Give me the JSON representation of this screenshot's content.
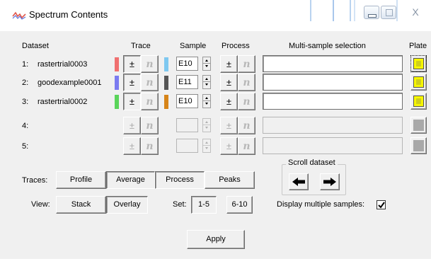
{
  "window": {
    "title": "Spectrum Contents",
    "close_glyph": "X"
  },
  "headers": {
    "dataset": "Dataset",
    "trace": "Trace",
    "sample": "Sample",
    "process": "Process",
    "multi_sample": "Multi-sample selection",
    "plate": "Plate"
  },
  "glyphs": {
    "toggle": "±",
    "n": "n"
  },
  "rows": [
    {
      "index": "1:",
      "name": "rastertrial0003",
      "color": "#f07070",
      "sample_color": "#7ec8f0",
      "sample": "E10",
      "plate_color": "yellow",
      "enabled": true
    },
    {
      "index": "2:",
      "name": "goodexample0001",
      "color": "#7b7bf0",
      "sample_color": "#555555",
      "sample": "E11",
      "plate_color": "yellow",
      "enabled": true
    },
    {
      "index": "3:",
      "name": "rastertrial0002",
      "color": "#5ad45a",
      "sample_color": "#d68418",
      "sample": "E10",
      "plate_color": "yellow",
      "enabled": true
    },
    {
      "index": "4:",
      "name": "",
      "sample": "",
      "plate_color": "grey",
      "enabled": false
    },
    {
      "index": "5:",
      "name": "",
      "sample": "",
      "plate_color": "grey",
      "enabled": false
    }
  ],
  "traces": {
    "label": "Traces:",
    "buttons": [
      "Profile",
      "Average",
      "Process",
      "Peaks"
    ],
    "pressed": [
      "Average",
      "Process"
    ]
  },
  "view": {
    "label": "View:",
    "buttons": [
      "Stack",
      "Overlay"
    ],
    "pressed": "Overlay"
  },
  "set": {
    "label": "Set:",
    "buttons": [
      "1-5",
      "6-10"
    ],
    "pressed": "1-5"
  },
  "scroll_dataset": {
    "label": "Scroll dataset"
  },
  "display_multiple": {
    "label": "Display multiple samples:",
    "checked": true
  },
  "apply_label": "Apply"
}
